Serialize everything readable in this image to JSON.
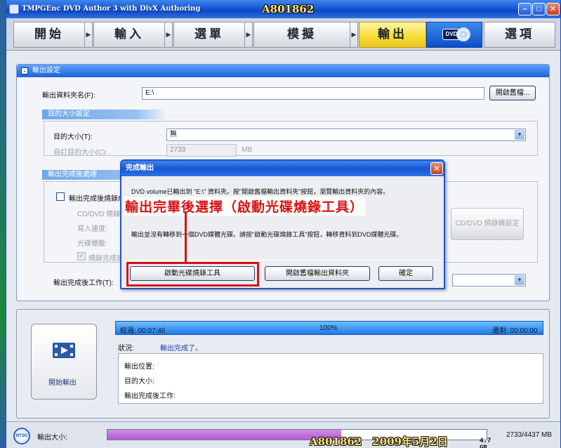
{
  "window": {
    "title": "TMPGEnc DVD Author 3 with DivX Authoring",
    "watermark": "A801862"
  },
  "steps": {
    "start": "開始",
    "input": "輸入",
    "menu": "選單",
    "simulate": "模擬",
    "output": "輸出",
    "dvd_badge": "DVD",
    "options": "選項"
  },
  "output_settings": {
    "header": "輸出設定",
    "folder_label": "輸出資料夾名(F):",
    "folder_value": "E:\\",
    "open_button": "開啟舊檔...",
    "target_size_section": "目的大小設定",
    "target_size_label": "目的大小(T):",
    "target_size_value": "無",
    "custom_size_label": "自訂目的大小(C):",
    "custom_size_value": "2733",
    "custom_size_unit": "MB",
    "post_section": "輸出完成後處理",
    "post_checkbox_label": "輸出完成後燒錄成",
    "burner_label": "CD/DVD 燒錄機",
    "write_speed_label": "寫入速度:",
    "disc_label_label": "光碟標籤:",
    "verify_label": "燒錄完成後",
    "burner_settings_button": "CD/DVD 燒錄機設定",
    "after_work_label": "輸出完成後工作(T):"
  },
  "dialog": {
    "title": "完成輸出",
    "message1": "DVD volume已輸出到 \"E:\\\" 資料夾。按\"開啟舊檔輸出資料夾\"按鈕，瀏覽輸出資料夾的內容。",
    "message2": "輸出並沒有轉移到一個DVD媒體光碟。請按\"啟動光碟燒錄工具\"按鈕，轉移資料到DVD媒體光碟。",
    "burn_tool_button": "啟動光碟燒錄工具",
    "open_folder_button": "開啟舊檔輸出資料夾",
    "ok_button": "確定"
  },
  "annotation": {
    "text": "輸出完畢後選擇（啟動光碟燒錄工具）"
  },
  "status_panel": {
    "start_output_label": "開始輸出",
    "elapsed": "經過: 00:07:46",
    "percent": "100%",
    "remaining": "還剩: 00:00:00",
    "progress": 1.0,
    "status_label": "狀況:",
    "status_value": "輸出完成了。",
    "output_location_label": "輸出位置:",
    "target_size_label": "目的大小:",
    "after_work_label": "輸出完成後工作:"
  },
  "statusbar": {
    "ntsc": "NTSC",
    "output_size_label": "輸出大小:",
    "watermark_text": "A801862　2009年5月2日",
    "disc_capacity": "4.7 GB",
    "size_readout": "2733/4437 MB",
    "fill_fraction": 0.616
  },
  "colors": {
    "accent_blue": "#1657d6",
    "active_step": "#f7dd3a",
    "annotation_red": "#d91414",
    "size_fill": "#b45ad2"
  }
}
